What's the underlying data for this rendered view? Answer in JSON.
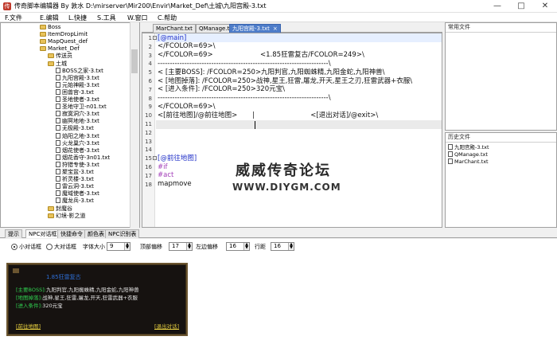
{
  "window": {
    "title": "传奇脚本编辑器  By  敦水  D:\\mirserver\\Mir200\\Envir\\Market_Def\\土城\\九阳宫殿-3.txt",
    "app_icon": "传"
  },
  "menu": [
    "F.文件",
    "E.编辑",
    "L.快捷",
    "S.工具",
    "W.窗口",
    "C.帮助"
  ],
  "tree": [
    {
      "label": "Boss",
      "kind": "folder",
      "level": 0
    },
    {
      "label": "ItemDropLimit",
      "kind": "folder",
      "level": 0
    },
    {
      "label": "MapQuest_def",
      "kind": "folder",
      "level": 0
    },
    {
      "label": "Market_Def",
      "kind": "folder",
      "level": 0
    },
    {
      "label": "传送员",
      "kind": "folder",
      "level": 1
    },
    {
      "label": "土城",
      "kind": "folder",
      "level": 1
    },
    {
      "label": "BOSS之家-3.txt",
      "kind": "file",
      "level": 2
    },
    {
      "label": "九阳宫殿-3.txt",
      "kind": "file",
      "level": 2
    },
    {
      "label": "元始神殿-3.txt",
      "kind": "file",
      "level": 2
    },
    {
      "label": "困兽宫-3.txt",
      "kind": "file",
      "level": 2
    },
    {
      "label": "圣地使者-3.txt",
      "kind": "file",
      "level": 2
    },
    {
      "label": "圣地守卫-n01.txt",
      "kind": "file",
      "level": 2
    },
    {
      "label": "寂寞洞穴-3.txt",
      "kind": "file",
      "level": 2
    },
    {
      "label": "幽冥地地-3.txt",
      "kind": "file",
      "level": 2
    },
    {
      "label": "无极殿-3.txt",
      "kind": "file",
      "level": 2
    },
    {
      "label": "焰阳之地-3.txt",
      "kind": "file",
      "level": 2
    },
    {
      "label": "火龙巢穴-3.txt",
      "kind": "file",
      "level": 2
    },
    {
      "label": "烟花使者-3.txt",
      "kind": "file",
      "level": 2
    },
    {
      "label": "烟花香守-3n01.txt",
      "kind": "file",
      "level": 2
    },
    {
      "label": "狩猎专使-3.txt",
      "kind": "file",
      "level": 2
    },
    {
      "label": "聚宝盆-3.txt",
      "kind": "file",
      "level": 2
    },
    {
      "label": "祈灵楼-3.txt",
      "kind": "file",
      "level": 2
    },
    {
      "label": "雷云洞-3.txt",
      "kind": "file",
      "level": 2
    },
    {
      "label": "魔域使者-3.txt",
      "kind": "file",
      "level": 2
    },
    {
      "label": "魔龙兵-3.txt",
      "kind": "file",
      "level": 2
    },
    {
      "label": "封魔谷",
      "kind": "folder",
      "level": 1
    },
    {
      "label": "幻境-影之道",
      "kind": "folder",
      "level": 1
    }
  ],
  "editor_tabs": [
    {
      "label": "MarChant.txt",
      "active": false
    },
    {
      "label": "QManage.txt",
      "active": false
    },
    {
      "label": "九阳宫殿-3.txt",
      "active": true
    }
  ],
  "editor_tab_close": "×",
  "code_lines": [
    {
      "n": "1",
      "text": "[@main]",
      "style": "blue",
      "fold": "-"
    },
    {
      "n": "2",
      "text": "</FCOLOR=69>\\",
      "style": "",
      "fold": ""
    },
    {
      "n": "3",
      "text": "</FCOLOR=69>                      <1.85狂雷复古/FCOLOR=249>\\",
      "style": "",
      "fold": ""
    },
    {
      "n": "4",
      "text": "----------------------------------------------------------------------\\",
      "style": "",
      "fold": ""
    },
    {
      "n": "5",
      "text": "< [主要BOSS]: /FCOLOR=250>九阳判官,九阳蜘蛛精,九阳金蛇,九阳神兽\\",
      "style": "",
      "fold": ""
    },
    {
      "n": "6",
      "text": "< [地图掉落]: /FCOLOR=250>战神,星王,狂雷,屠龙,开天,星王之刃,狂雷武器+衣服\\",
      "style": "",
      "fold": ""
    },
    {
      "n": "7",
      "text": "< [进入条件]: /FCOLOR=250>320元宝\\",
      "style": "",
      "fold": ""
    },
    {
      "n": "8",
      "text": "----------------------------------------------------------------------\\",
      "style": "",
      "fold": ""
    },
    {
      "n": "9",
      "text": "</FCOLOR=69>\\",
      "style": "",
      "fold": ""
    },
    {
      "n": "10",
      "text": "<[前往地图]/@前往地图>       |                          <[退出对话]/@exit>\\",
      "style": "",
      "fold": ""
    },
    {
      "n": "11",
      "text": "",
      "style": "",
      "fold": ""
    },
    {
      "n": "12",
      "text": "",
      "style": "",
      "fold": ""
    },
    {
      "n": "13",
      "text": "",
      "style": "",
      "fold": ""
    },
    {
      "n": "14",
      "text": "",
      "style": "",
      "fold": ""
    },
    {
      "n": "15",
      "text": "[@前往地图]",
      "style": "blue",
      "fold": "-"
    },
    {
      "n": "16",
      "text": "#if",
      "style": "purple",
      "fold": ""
    },
    {
      "n": "17",
      "text": "#act",
      "style": "purple",
      "fold": ""
    },
    {
      "n": "18",
      "text": "mapmove",
      "style": "",
      "fold": ""
    }
  ],
  "watermark": {
    "title": "威威传奇论坛",
    "url": "WWW.DIYGM.COM"
  },
  "common_files": {
    "title": "常用文件"
  },
  "history": {
    "title": "历史文件",
    "items": [
      "九阳宫殿-3.txt",
      "QManage.txt",
      "MarChant.txt"
    ]
  },
  "bottom_tabs": [
    {
      "label": "提示",
      "active": false
    },
    {
      "label": "NPC对话框",
      "active": true
    },
    {
      "label": "快捷命令",
      "active": false
    },
    {
      "label": "颜色表",
      "active": false
    },
    {
      "label": "NPC识别表",
      "active": false
    }
  ],
  "options": {
    "small_dialog": "小对话框",
    "big_dialog": "大对话框",
    "font_size_label": "字体大小",
    "font_size": "9",
    "top_offset_label": "顶部偏移",
    "top_offset": "17",
    "left_offset_label": "左边偏移",
    "left_offset": "16",
    "line_height_label": "行距",
    "line_height": "16",
    "spin_up": "▲",
    "spin_down": "▼"
  },
  "preview": {
    "header": "1.85狂雷复古",
    "lines": [
      {
        "label": "[主要BOSS]:",
        "value": "九阳判官,九阳蜘蛛精,九阳金蛇,九阳神兽"
      },
      {
        "label": "[地图掉落]:",
        "value": "战神,星王,狂雷,屠龙,开天,狂雷武器+衣服"
      },
      {
        "label": "[进入条件]:",
        "value": "320元宝"
      }
    ],
    "go_link": "[前往地图]",
    "exit_link": "[退出对话]"
  },
  "colors": {
    "active_tab": "#4d7cc9",
    "code_blue": "#2030c8",
    "code_purple": "#a23cb8",
    "preview_bg": "#161210"
  }
}
